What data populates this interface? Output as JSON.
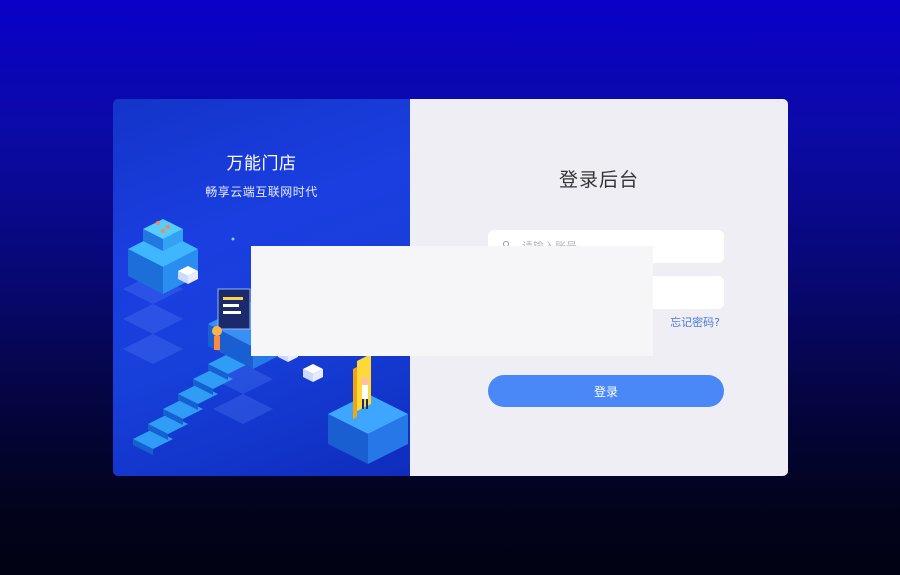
{
  "brand": {
    "title": "万能门店",
    "subtitle": "畅享云端互联网时代"
  },
  "login": {
    "title": "登录后台",
    "account_placeholder": "请输入账号",
    "password_placeholder": "",
    "forgot_label": "忘记密码?",
    "submit_label": "登录"
  },
  "colors": {
    "left_panel": "#1a3ee0",
    "right_panel": "#eeeef4",
    "button": "#4a87f7",
    "link": "#4a79d6"
  },
  "icons": {
    "account": "user-icon"
  }
}
